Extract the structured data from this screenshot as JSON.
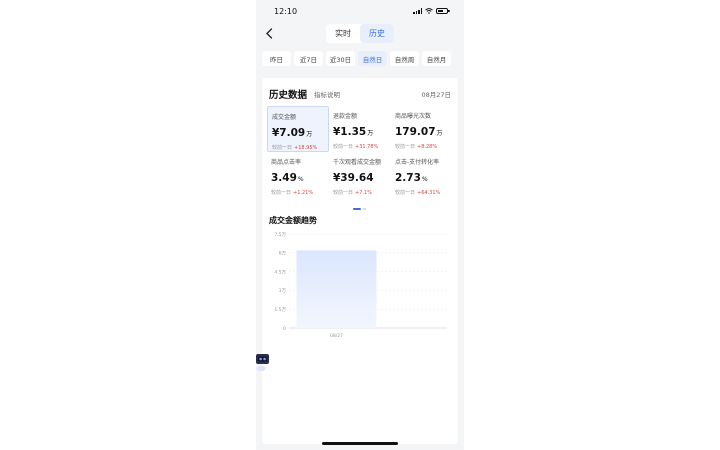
{
  "status": {
    "time": "12:10"
  },
  "nav": {
    "tabs": [
      {
        "label": "实时"
      },
      {
        "label": "历史"
      }
    ],
    "active_tab": 1
  },
  "periods": [
    {
      "label": "昨日"
    },
    {
      "label": "近7日"
    },
    {
      "label": "近30日"
    },
    {
      "label": "自然日"
    },
    {
      "label": "自然周"
    },
    {
      "label": "自然月"
    }
  ],
  "active_period": 3,
  "card": {
    "title": "历史数据",
    "subtitle": "指标说明",
    "date": "08月27日",
    "metrics": [
      {
        "label": "成交金额",
        "value": "¥7.09",
        "unit": "万",
        "compare": "较前一日",
        "change": "+18.95%"
      },
      {
        "label": "退款金额",
        "value": "¥1.35",
        "unit": "万",
        "compare": "较前一日",
        "change": "+31.78%"
      },
      {
        "label": "商品曝光次数",
        "value": "179.07",
        "unit": "万",
        "compare": "较前一日",
        "change": "+8.28%"
      },
      {
        "label": "商品点击率",
        "value": "3.49",
        "unit": "%",
        "compare": "较前一日",
        "change": "+1.21%"
      },
      {
        "label": "千次观看成交金额",
        "value": "¥39.64",
        "unit": "",
        "compare": "较前一日",
        "change": "+7.1%"
      },
      {
        "label": "点击-支付转化率",
        "value": "2.73",
        "unit": "%",
        "compare": "较前一日",
        "change": "+64.31%"
      }
    ]
  },
  "trend": {
    "title": "成交金额趋势"
  },
  "chart_data": {
    "type": "bar",
    "categories": [
      "08/27"
    ],
    "values": [
      6.2
    ],
    "ylim": [
      0,
      7.5
    ],
    "y_ticks": [
      "0",
      "1.5万",
      "3万",
      "4.5万",
      "6万",
      "7.5万"
    ],
    "grid": true,
    "bar_color": "#dbe6fd"
  }
}
